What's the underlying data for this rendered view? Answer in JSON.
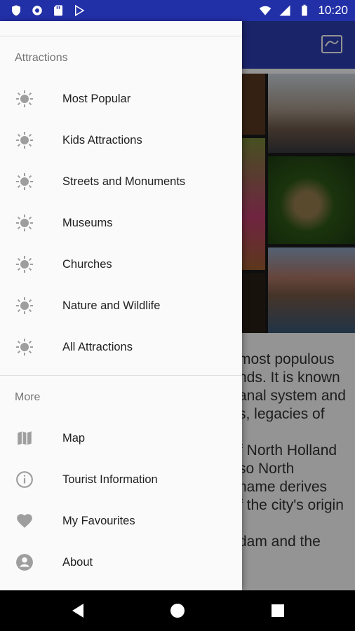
{
  "status_bar": {
    "time": "10:20"
  },
  "drawer": {
    "attractions_header": "Attractions",
    "attractions": [
      {
        "label": "Most Popular",
        "icon": "sun-icon"
      },
      {
        "label": "Kids Attractions",
        "icon": "sun-icon"
      },
      {
        "label": "Streets and Monuments",
        "icon": "sun-icon"
      },
      {
        "label": "Museums",
        "icon": "sun-icon"
      },
      {
        "label": "Churches",
        "icon": "sun-icon"
      },
      {
        "label": "Nature and Wildlife",
        "icon": "sun-icon"
      },
      {
        "label": "All Attractions",
        "icon": "sun-icon"
      }
    ],
    "more_header": "More",
    "more": [
      {
        "label": "Map",
        "icon": "map-icon"
      },
      {
        "label": "Tourist Information",
        "icon": "info-icon"
      },
      {
        "label": "My Favourites",
        "icon": "heart-icon"
      },
      {
        "label": "About",
        "icon": "account-icon"
      }
    ]
  },
  "article": {
    "lines": [
      "most populous",
      "nds. It is known",
      "anal system and",
      "s, legacies of",
      "",
      "f North Holland",
      "so North",
      "name derives",
      "f the city's origin",
      "",
      "dam and the"
    ]
  },
  "colors": {
    "status_bar": "#2230a8",
    "toolbar": "#2e3fb5",
    "drawer_bg": "#fafafa",
    "icon_gray": "#9e9e9e"
  }
}
